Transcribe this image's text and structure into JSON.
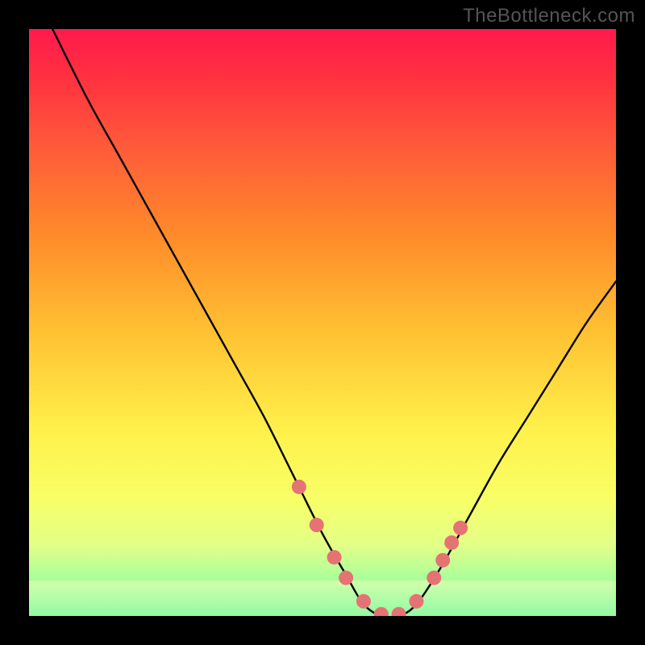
{
  "attribution": "TheBottleneck.com",
  "chart_data": {
    "type": "line",
    "title": "",
    "xlabel": "",
    "ylabel": "",
    "xlim": [
      0,
      100
    ],
    "ylim": [
      0,
      100
    ],
    "series": [
      {
        "name": "bottleneck-curve",
        "x": [
          4,
          10,
          15,
          20,
          25,
          30,
          35,
          40,
          45,
          50,
          54,
          57,
          60,
          63,
          66,
          70,
          75,
          80,
          85,
          90,
          95,
          100
        ],
        "y": [
          100,
          88,
          79,
          70,
          61,
          52,
          43,
          34,
          24,
          14,
          7,
          2,
          0,
          0,
          2,
          8,
          17,
          26,
          34,
          42,
          50,
          57
        ]
      }
    ],
    "markers": {
      "name": "highlight-dots",
      "x": [
        46,
        49,
        52,
        54,
        57,
        60,
        63,
        66,
        69,
        70.5,
        72,
        73.5
      ],
      "y": [
        22,
        15.5,
        10,
        6.5,
        2.5,
        0.3,
        0.3,
        2.5,
        6.5,
        9.5,
        12.5,
        15
      ],
      "color": "#e57373",
      "radius_px": 9
    },
    "bottom_haze_band": {
      "from_y": 0,
      "to_y": 6,
      "color": "#f6ffb8",
      "opacity": 0.55
    }
  }
}
